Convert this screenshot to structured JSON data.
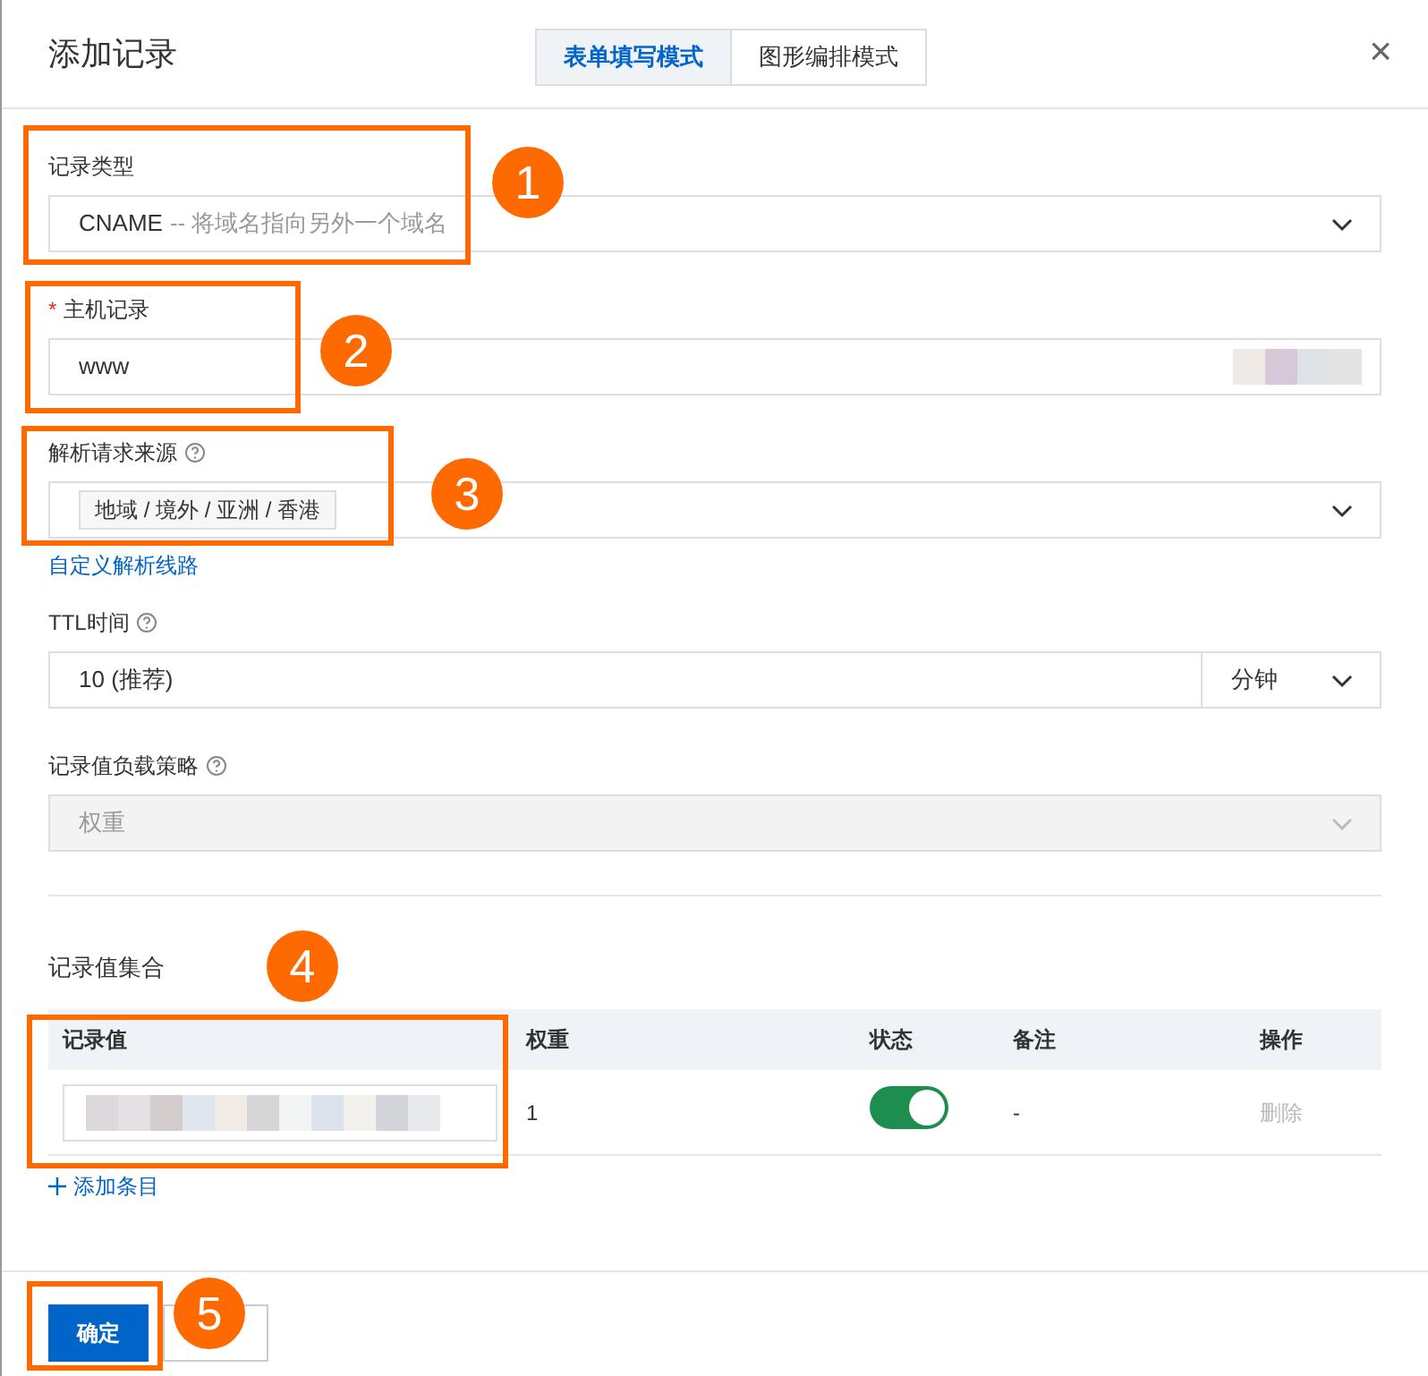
{
  "dialog": {
    "title": "添加记录",
    "close": "×"
  },
  "mode_tabs": [
    {
      "label": "表单填写模式",
      "selected": true
    },
    {
      "label": "图形编排模式",
      "selected": false
    }
  ],
  "fields": [
    {
      "kind": "select",
      "label": "记录类型",
      "value": "CNAME",
      "hint": "-- 将域名指向另外一个域名"
    },
    {
      "kind": "input",
      "label": "主机记录",
      "value": "www",
      "required_mark": "*",
      "redacted": true
    },
    {
      "kind": "tags",
      "label": "解析请求来源",
      "help": true,
      "tags": [
        "地域 / 境外 / 亚洲 / 香港"
      ],
      "link": "自定义解析线路"
    },
    {
      "kind": "unit",
      "label": "TTL时间",
      "help": true,
      "value": "10 (推荐)",
      "unit": "分钟"
    },
    {
      "kind": "select",
      "label": "记录值负载策略",
      "help": true,
      "value": "权重",
      "disabled": true
    }
  ],
  "records": {
    "title": "记录值集合",
    "columns": [
      "记录值",
      "权重",
      "状态",
      "备注",
      "操作"
    ],
    "rows": [
      {
        "weight": "1",
        "on": true,
        "note": "-",
        "action": "删除",
        "action_disabled": true
      }
    ],
    "add_link": "添加条目"
  },
  "buttons": [
    {
      "label": "确定",
      "kind": "primary"
    },
    {
      "kind": "secondary"
    }
  ],
  "annotations": [
    {
      "number": "1"
    },
    {
      "number": "2"
    },
    {
      "number": "3"
    },
    {
      "number": "4"
    },
    {
      "number": "5"
    }
  ]
}
